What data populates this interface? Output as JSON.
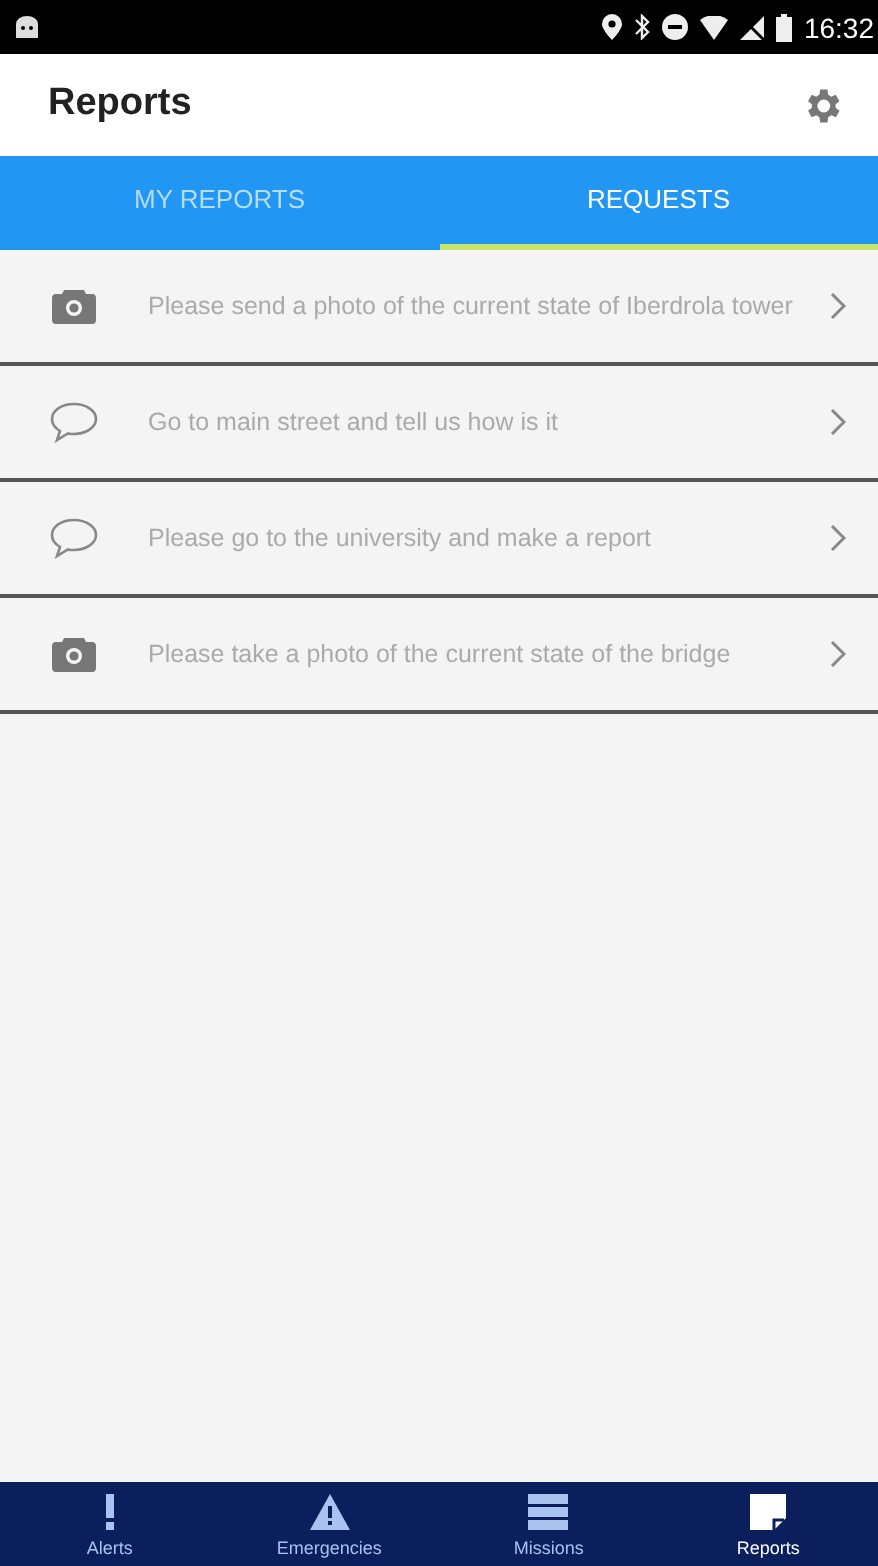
{
  "status_bar": {
    "time": "16:32"
  },
  "header": {
    "title": "Reports"
  },
  "tabs": [
    {
      "label": "MY REPORTS",
      "selected": false
    },
    {
      "label": "REQUESTS",
      "selected": true
    }
  ],
  "requests": [
    {
      "kind": "photo",
      "text": "Please send a photo of the current state of Iberdrola tower"
    },
    {
      "kind": "message",
      "text": "Go to main street and tell us how is it"
    },
    {
      "kind": "message",
      "text": "Please go to the university and make a report"
    },
    {
      "kind": "photo",
      "text": "Please take a photo of the current state of the bridge"
    }
  ],
  "bottom_nav": [
    {
      "kind": "alerts",
      "label": "Alerts",
      "selected": false
    },
    {
      "kind": "emergencies",
      "label": "Emergencies",
      "selected": false
    },
    {
      "kind": "missions",
      "label": "Missions",
      "selected": false
    },
    {
      "kind": "reports",
      "label": "Reports",
      "selected": true
    }
  ]
}
